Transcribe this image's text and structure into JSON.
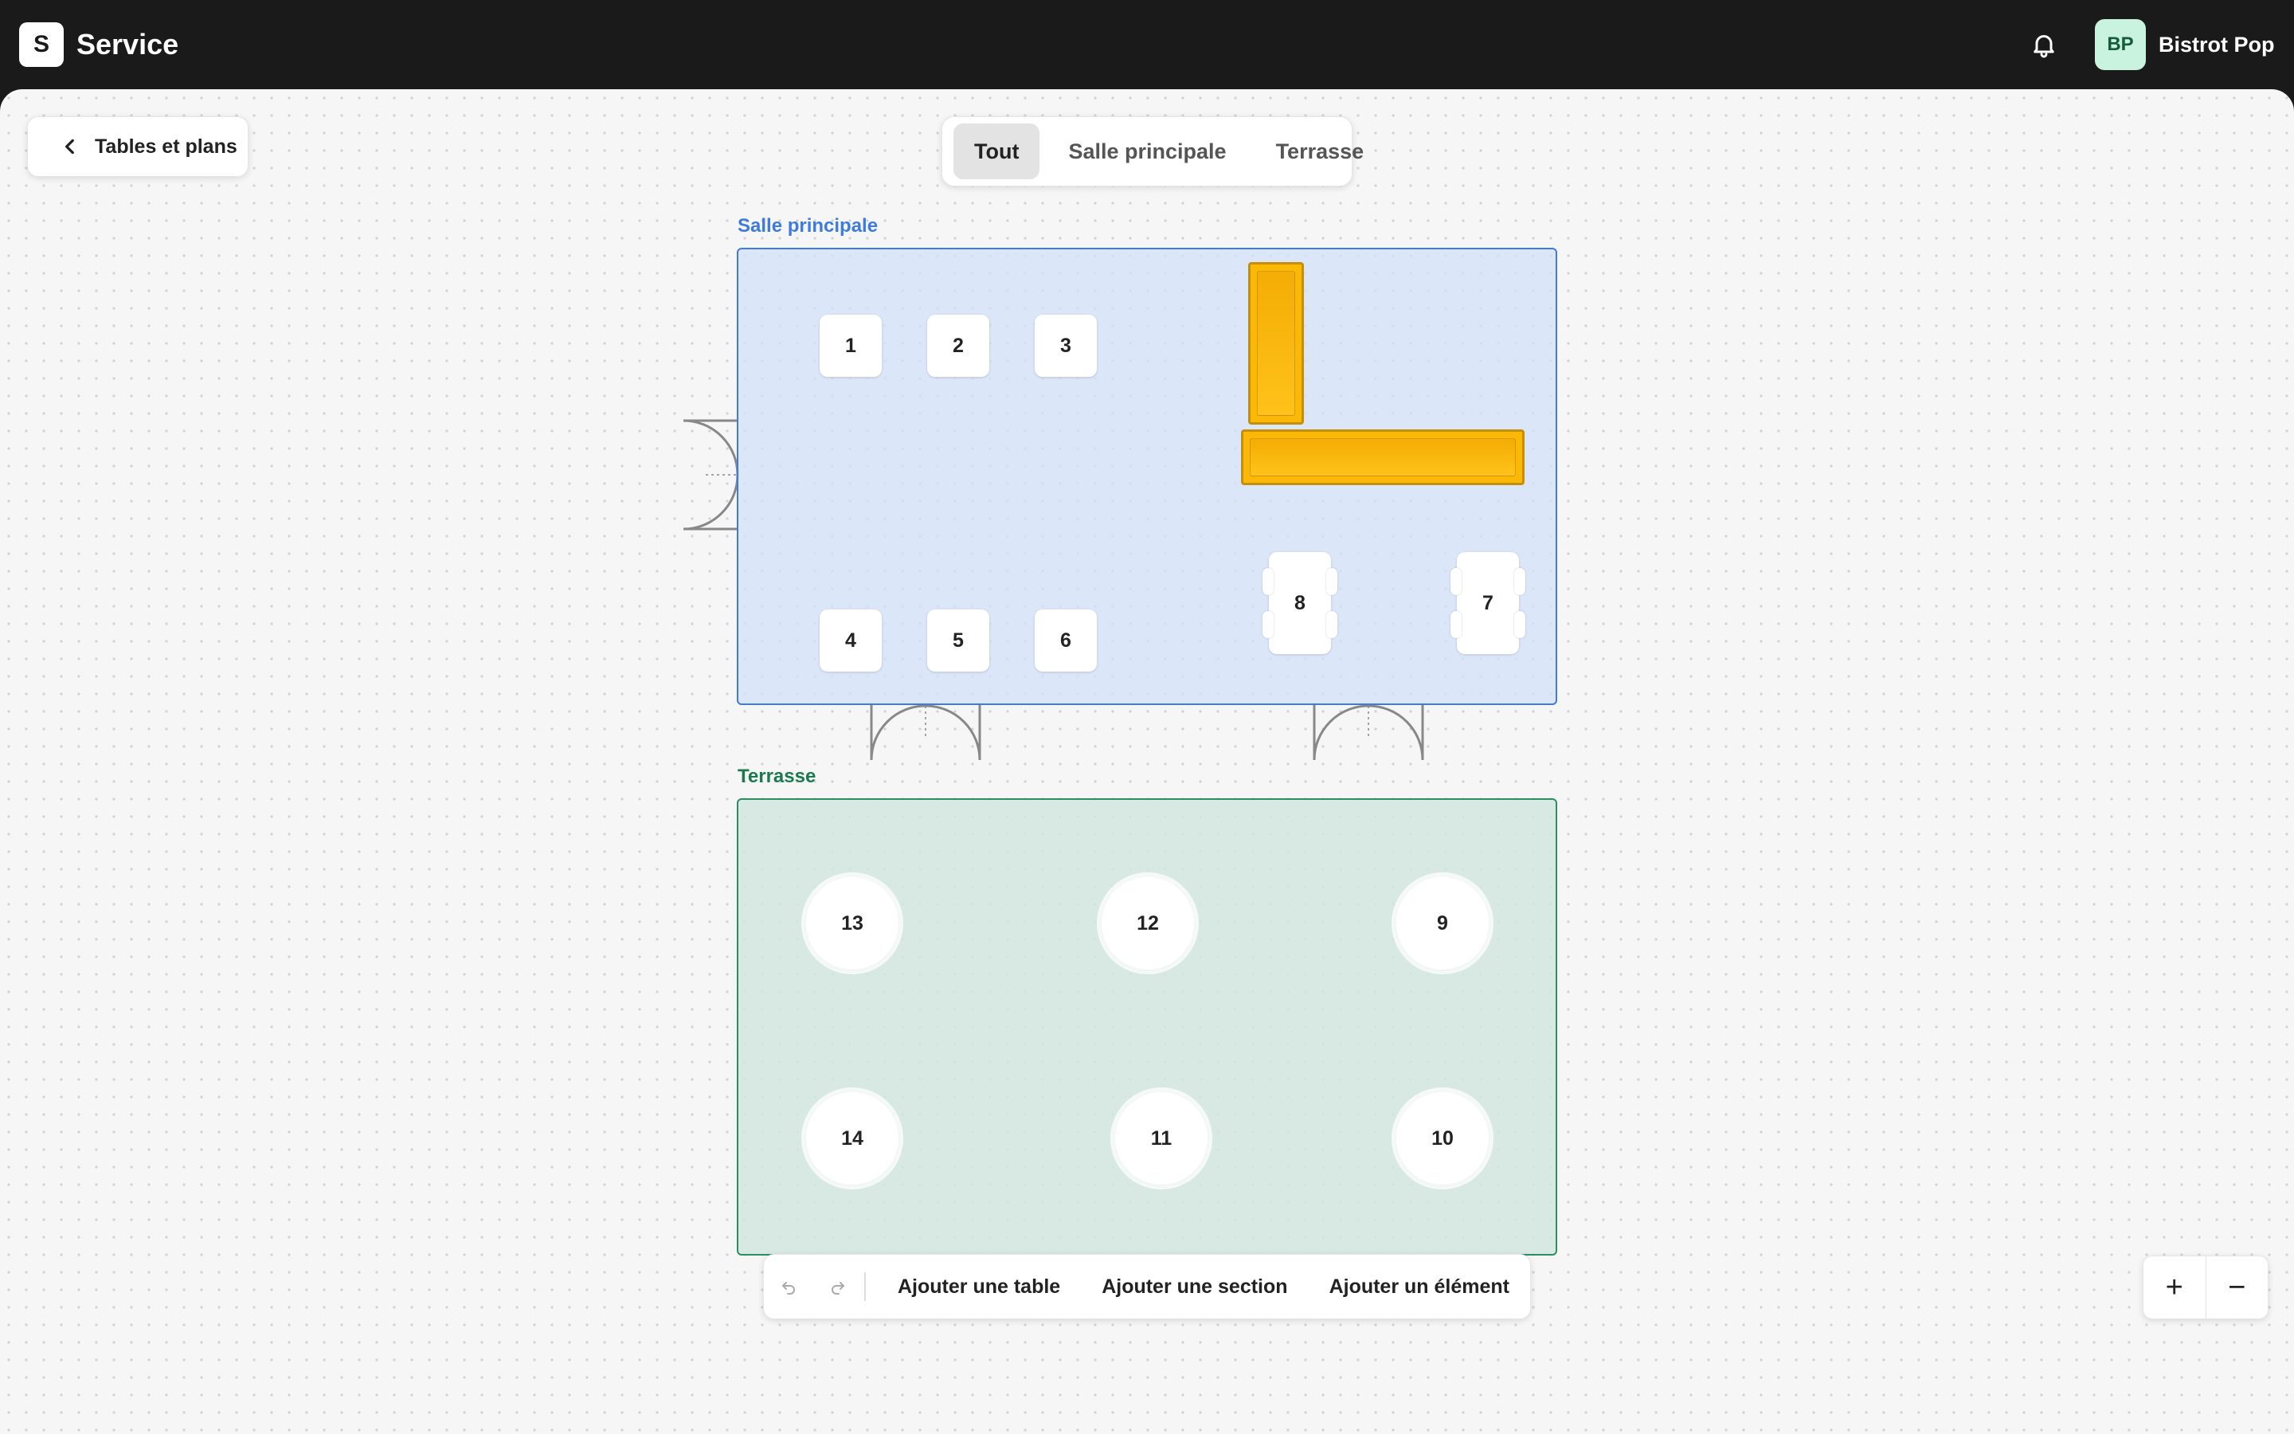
{
  "app": {
    "logo_letter": "S",
    "title": "Service"
  },
  "account": {
    "initials": "BP",
    "name": "Bistrot Pop"
  },
  "back_button": {
    "label": "Tables et plans"
  },
  "filter_tabs": [
    {
      "label": "Tout",
      "active": true
    },
    {
      "label": "Salle principale",
      "active": false
    },
    {
      "label": "Terrasse",
      "active": false
    }
  ],
  "sections": {
    "main": {
      "label": "Salle principale",
      "color": "#3d7be0"
    },
    "terrace": {
      "label": "Terrasse",
      "color": "#1b7a4e"
    }
  },
  "tables": {
    "t1": "1",
    "t2": "2",
    "t3": "3",
    "t4": "4",
    "t5": "5",
    "t6": "6",
    "t7": "7",
    "t8": "8",
    "t9": "9",
    "t10": "10",
    "t11": "11",
    "t12": "12",
    "t13": "13",
    "t14": "14"
  },
  "toolbar": {
    "undo_icon": "undo-icon",
    "redo_icon": "redo-icon",
    "add_table": "Ajouter une table",
    "add_section": "Ajouter une section",
    "add_element": "Ajouter un élément"
  },
  "zoom": {
    "in": "+",
    "out": "−"
  },
  "colors": {
    "bar": "#fbb806",
    "topbar": "#1a1a1a",
    "avatar_bg": "#c9f2df"
  }
}
